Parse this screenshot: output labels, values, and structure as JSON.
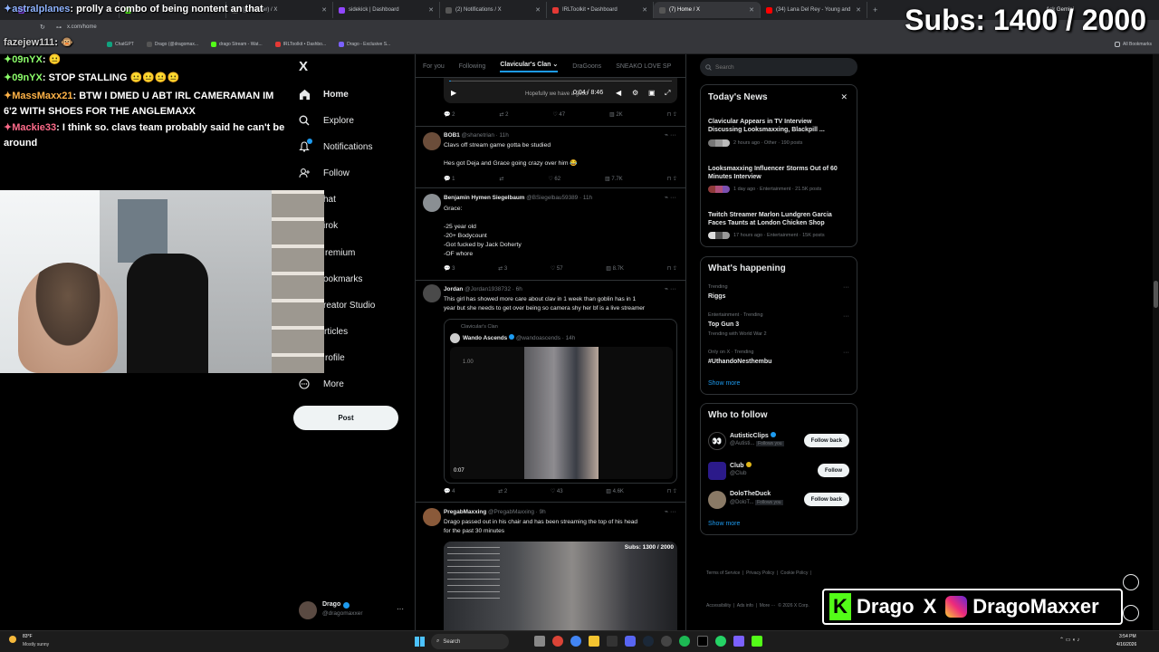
{
  "browser": {
    "tabs": [
      {
        "label": "",
        "color": "#9146ff"
      },
      {
        "label": "",
        "color": "#53fc18"
      },
      {
        "label": "(gomaxxer) / X",
        "color": "#555"
      },
      {
        "label": "sidekick | Dashboard",
        "color": "#9146ff"
      },
      {
        "label": "(2) Notifications / X",
        "color": "#555"
      },
      {
        "label": "IRLToolkit • Dashboard",
        "color": "#e53935"
      },
      {
        "label": "(7) Home / X",
        "color": "#555"
      },
      {
        "label": "(34) Lana Del Rey - Young and",
        "color": "#ff0000"
      }
    ],
    "url": "x.com/home",
    "ask_gemini": "Ask Gemini",
    "bookmarks": [
      {
        "label": "ChatGPT",
        "color": "#10a37f"
      },
      {
        "label": "Drago (@dragomax...",
        "color": "#555"
      },
      {
        "label": "drago Stream - Wat...",
        "color": "#53fc18"
      },
      {
        "label": "IRLToolkit • Dashbo...",
        "color": "#e53935"
      },
      {
        "label": "Drago - Exclusive S...",
        "color": "#7b61ff"
      }
    ],
    "all_bookmarks": "All Bookmarks"
  },
  "chat": {
    "lines": [
      {
        "user": "astralplanes",
        "text": " prolly a combo of being nontent an that",
        "color": "#8fb4ff"
      },
      {
        "user": "fazejew111",
        "text": "",
        "color": "#d0d0d0"
      },
      {
        "user": "09nYX",
        "text": "",
        "color": "#8dff6b"
      },
      {
        "user": "09nYX",
        "text": " STOP STALLING",
        "color": "#8dff6b"
      },
      {
        "user": "MassMaxx21",
        "text": " BTW I DMED U ABT IRL CAMERAMAN IM 6'2 WITH SHOES FOR THE ANGLEMAXX",
        "color": "#ffb347"
      },
      {
        "user": "Mackie33",
        "text": " I think so. clavs team probably said he can't be around",
        "color": "#ff6b8a"
      }
    ]
  },
  "overlay": {
    "subs": "Subs: 1400 / 2000",
    "brand_name": "Drago",
    "brand_handle": "DragoMaxxer"
  },
  "nav": {
    "logo": "X",
    "items": [
      {
        "label": "Home",
        "icon": "home-icon"
      },
      {
        "label": "Explore",
        "icon": "search-icon"
      },
      {
        "label": "Notifications",
        "icon": "bell-icon"
      },
      {
        "label": "Follow",
        "icon": "person-plus-icon"
      },
      {
        "label": "hat",
        "icon": "chat-icon"
      },
      {
        "label": "irok",
        "icon": "grok-icon"
      },
      {
        "label": "remium",
        "icon": "premium-icon"
      },
      {
        "label": "ookmarks",
        "icon": "bookmark-icon"
      },
      {
        "label": "reator Studio",
        "icon": "studio-icon"
      },
      {
        "label": "rticles",
        "icon": "article-icon"
      },
      {
        "label": "rofile",
        "icon": "profile-icon"
      },
      {
        "label": "More",
        "icon": "more-circle-icon"
      }
    ],
    "post": "Post",
    "account_name": "Drago",
    "account_handle": "@dragomaxxer"
  },
  "feed": {
    "tabs": [
      "For you",
      "Following",
      "Clavicular's Clan",
      "DraGoons",
      "SNEAKO LOVE SP"
    ],
    "video_time": "0:04 / 8:46",
    "video_caption": "Hopefully we have a good",
    "top_actions": [
      "2",
      "2",
      "47",
      "2K"
    ],
    "tweets": [
      {
        "name": "BOB1",
        "handle": "@shanetrian · 11h",
        "lines": [
          "Clavs off stream game gotta be studied",
          "",
          "Hes got Deja and Grace going crazy over him 😂"
        ],
        "actions": [
          "1",
          "",
          "62",
          "7.7K"
        ]
      },
      {
        "name": "Benjamin Hymen Siegelbaum",
        "handle": "@BSiegelbau59389 · 11h",
        "lines": [
          "Grace:",
          "",
          "-25 year old",
          "-20+ Bodycount",
          "-Got fucked by Jack Doherty",
          "-OF whore"
        ],
        "actions": [
          "3",
          "3",
          "57",
          "8.7K"
        ]
      },
      {
        "name": "Jordan",
        "handle": "@Jordan1938732 · 6h",
        "lines": [
          "This girl has showed more care about clav in 1 week than goblin has in 1",
          "year but she needs to get over being so camera shy her bf is a live streamer"
        ],
        "actions": [
          "4",
          "2",
          "43",
          "4.6K"
        ]
      },
      {
        "name": "PregabMaxxing",
        "handle": "@PregabMaxxing · 9h",
        "lines": [
          "Drago passed out in his chair and has been streaming the top of his head",
          "for the past 30 minutes"
        ],
        "actions": []
      }
    ],
    "quote": {
      "community": "Clavicular's Clan",
      "name": "Wando Ascends",
      "handle": "@wandoascends · 14h",
      "time": "0:07",
      "rate": "1.00"
    },
    "embed_subs": "Subs: 1300 / 2000"
  },
  "right": {
    "search_placeholder": "Search",
    "news_title": "Today's News",
    "news": [
      {
        "title": "Clavicular Appears in TV Interview Discussing Looksmaxxing, Blackpill ...",
        "meta": "2 hours ago · Other · 190 posts"
      },
      {
        "title": "Looksmaxxing Influencer Storms Out of 60 Minutes Interview",
        "meta": "1 day ago · Entertainment · 21.5K posts"
      },
      {
        "title": "Twitch Streamer Marlon Lundgren Garcia Faces Taunts at London Chicken Shop",
        "meta": "17 hours ago · Entertainment · 15K posts"
      }
    ],
    "happening_title": "What's happening",
    "trends": [
      {
        "meta": "Trending",
        "title": "Riggs",
        "extra": ""
      },
      {
        "meta": "Entertainment · Trending",
        "title": "Top Gun 3",
        "extra": "Trending with World War 2"
      },
      {
        "meta": "Only on X · Trending",
        "title": "#UthandoNesthembu",
        "extra": ""
      }
    ],
    "show_more": "Show more",
    "follow_title": "Who to follow",
    "follows": [
      {
        "name": "AutisticClips",
        "handle": "@Autisti...",
        "badge": "Follows you",
        "button": "Follow back"
      },
      {
        "name": "Club",
        "handle": "@Club",
        "badge": "",
        "button": "Follow"
      },
      {
        "name": "DoloTheDuck",
        "handle": "@DoloT...",
        "badge": "Follows you",
        "button": "Follow back"
      }
    ],
    "footer1": "Terms of Service  |  Privacy Policy  |  Cookie Policy  |",
    "footer2": "Accessibility  |  Ads info  |  More ···  © 2026 X Corp."
  },
  "taskbar": {
    "weather_temp": "83°F",
    "weather_desc": "Mostly sunny",
    "search": "Search",
    "time": "3:54 PM",
    "date": "4/16/2026"
  }
}
